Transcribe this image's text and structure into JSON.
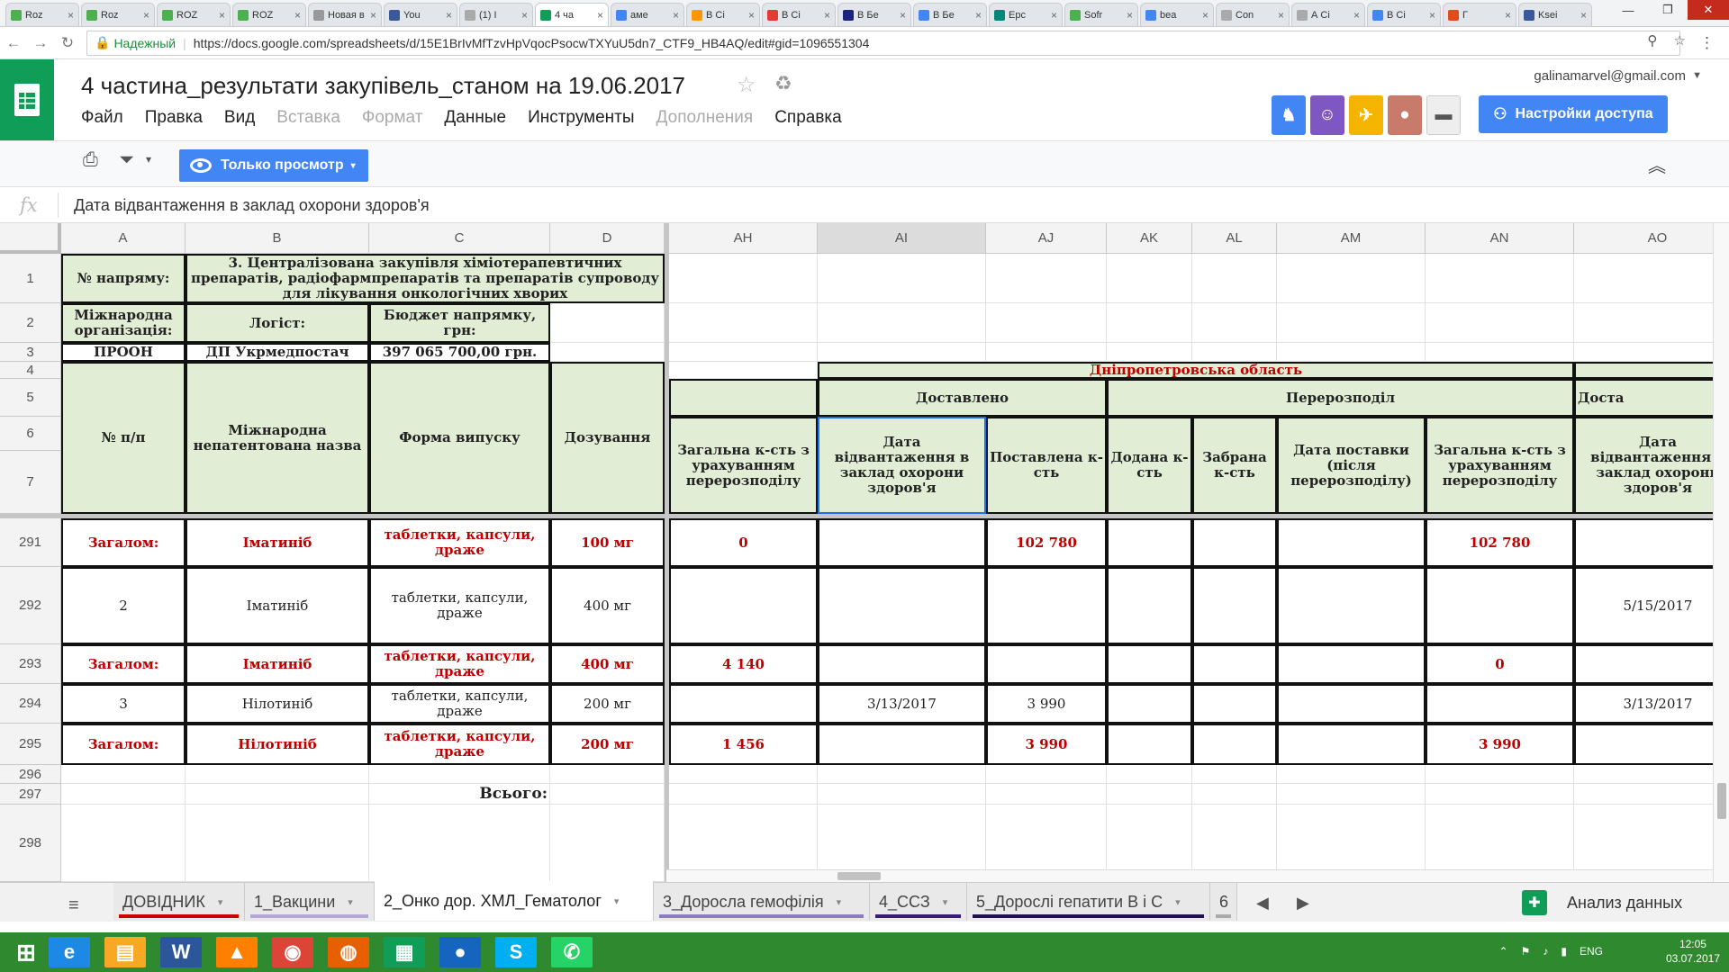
{
  "browser": {
    "tabs": [
      {
        "label": "Roz",
        "color": "#4caf50",
        "active": false
      },
      {
        "label": "Roz",
        "color": "#4caf50",
        "active": false
      },
      {
        "label": "ROZ",
        "color": "#4caf50",
        "active": false
      },
      {
        "label": "ROZ",
        "color": "#4caf50",
        "active": false
      },
      {
        "label": "Новая в",
        "color": "#999999",
        "active": false
      },
      {
        "label": "You",
        "color": "#3b5998",
        "active": false
      },
      {
        "label": "(1) I",
        "color": "#aaaaaa",
        "active": false
      },
      {
        "label": "4 ча",
        "color": "#0f9d58",
        "active": true
      },
      {
        "label": "аме",
        "color": "#4285f4",
        "active": false
      },
      {
        "label": "В Сі",
        "color": "#ff9800",
        "active": false
      },
      {
        "label": "В Сі",
        "color": "#e53935",
        "active": false
      },
      {
        "label": "В Бе",
        "color": "#1a237e",
        "active": false
      },
      {
        "label": "В Бе",
        "color": "#4285f4",
        "active": false
      },
      {
        "label": "Ерс",
        "color": "#00897b",
        "active": false
      },
      {
        "label": "Sofr",
        "color": "#4caf50",
        "active": false
      },
      {
        "label": "bea",
        "color": "#4285f4",
        "active": false
      },
      {
        "label": "Con",
        "color": "#aaaaaa",
        "active": false
      },
      {
        "label": "А Сі",
        "color": "#aaaaaa",
        "active": false
      },
      {
        "label": "В Сі",
        "color": "#4285f4",
        "active": false
      },
      {
        "label": "Г",
        "color": "#e64a19",
        "active": false
      },
      {
        "label": "Ksei",
        "color": "#3b5998",
        "active": false
      }
    ],
    "tab_close": "×",
    "back": "←",
    "forward": "→",
    "reload": "↻",
    "secure_label": "Надежный",
    "url": "https://docs.google.com/spreadsheets/d/15E1BrIvMfTzvHpVqocPsocwTXYuU5dn7_CTF9_HB4AQ/edit#gid=1096551304",
    "icons": {
      "zoom": "⚲",
      "star": "☆",
      "menu": "⋮"
    },
    "window": {
      "minimize": "—",
      "maximize": "❐",
      "close": "✕"
    }
  },
  "doc": {
    "title": "4 частина_результати закупівель_станом на 19.06.2017",
    "star": "☆",
    "drive_icon": "♻",
    "account": "galinamarvel@gmail.com",
    "account_caret": "▼",
    "menu": [
      {
        "label": "Файл",
        "enabled": true
      },
      {
        "label": "Правка",
        "enabled": true
      },
      {
        "label": "Вид",
        "enabled": true
      },
      {
        "label": "Вставка",
        "enabled": false
      },
      {
        "label": "Формат",
        "enabled": false
      },
      {
        "label": "Данные",
        "enabled": true
      },
      {
        "label": "Инструменты",
        "enabled": true
      },
      {
        "label": "Дополнения",
        "enabled": false
      },
      {
        "label": "Справка",
        "enabled": true
      }
    ],
    "collaborators": [
      {
        "icon": "♞",
        "color": "#4285f4"
      },
      {
        "icon": "☺",
        "color": "#7e57c2"
      },
      {
        "icon": "✈",
        "color": "#f4b400"
      },
      {
        "icon": "●",
        "color": "#c97b6b"
      },
      {
        "icon": "▬",
        "color": "#eeeeee"
      }
    ],
    "share_label": "Настройки доступа",
    "share_icon": "⚇"
  },
  "toolbar": {
    "print_icon": "⎙",
    "filter_icon": "⏷",
    "filter_caret": "▾",
    "view_only_label": "Только просмотр",
    "view_only_caret": "▾",
    "collapse_icon": "︽"
  },
  "formula_bar": {
    "fx": "fx",
    "value": "Дата відвантаження в заклад охорони здоров'я"
  },
  "grid": {
    "columns": [
      "A",
      "B",
      "C",
      "D",
      "AH",
      "AI",
      "AJ",
      "AK",
      "AL",
      "AM",
      "AN",
      "AO"
    ],
    "rows": [
      "1",
      "2",
      "3",
      "4",
      "5",
      "6",
      "7",
      "291",
      "292",
      "293",
      "294",
      "295",
      "296",
      "297",
      "298"
    ],
    "header": {
      "direction_label": "№ напряму:",
      "direction_value": "3. Централізована закупівля хіміотерапевтичних препаратів, радіофармпрепаратів та препаратів супроводу для лікування онкологічних хворих",
      "org_label": "Міжнародна організація:",
      "logist_label": "Логіст:",
      "budget_label": "Бюджет напрямку, грн:",
      "org_value": "ПРООН",
      "logist_value": "ДП  Укрмедпостач",
      "budget_value": "397 065 700,00 грн.",
      "np": "№ п/п",
      "inn": "Міжнародна непатентована назва",
      "form": "Форма випуску",
      "dosage": "Дозування",
      "region": "Дніпропетровська область",
      "delivered": "Доставлено",
      "redistribution": "Перерозподіл",
      "delivered_cut": "Доста",
      "total_qty": "Загальна к-сть з урахуванням перерозподілу",
      "ship_date": "Дата відвантаження в заклад охорони здоров'я",
      "supplied_qty": "Поставлена к-сть",
      "added_qty": "Додана к-сть",
      "taken_qty": "Забрана к-сть",
      "delivery_date_after": "Дата поставки (після перерозподілу)",
      "total_qty_2": "Загальна к-сть з урахуванням перерозподілу",
      "ship_date_2": "Дата відвантаження в заклад охорони здоров'я"
    },
    "data_rows": [
      {
        "type": "total",
        "a": "Загалом:",
        "b": "Іматиніб",
        "c": "таблетки, капсули, драже",
        "d": "100 мг",
        "ah": "0",
        "ai": "",
        "aj": "102 780",
        "ak": "",
        "al": "",
        "am": "",
        "an": "102 780",
        "ao": ""
      },
      {
        "type": "item",
        "a": "2",
        "b": "Іматиніб",
        "c": "таблетки, капсули, драже",
        "d": "400 мг",
        "ah": "",
        "ai": "",
        "aj": "",
        "ak": "",
        "al": "",
        "am": "",
        "an": "",
        "ao": "5/15/2017"
      },
      {
        "type": "total",
        "a": "Загалом:",
        "b": "Іматиніб",
        "c": "таблетки, капсули, драже",
        "d": "400 мг",
        "ah": "4 140",
        "ai": "",
        "aj": "",
        "ak": "",
        "al": "",
        "am": "",
        "an": "0",
        "ao": ""
      },
      {
        "type": "item",
        "a": "3",
        "b": "Нілотиніб",
        "c": "таблетки, капсули, драже",
        "d": "200 мг",
        "ah": "",
        "ai": "3/13/2017",
        "aj": "3 990",
        "ak": "",
        "al": "",
        "am": "",
        "an": "",
        "ao": "3/13/2017"
      },
      {
        "type": "total",
        "a": "Загалом:",
        "b": "Нілотиніб",
        "c": "таблетки, капсули, драже",
        "d": "200 мг",
        "ah": "1 456",
        "ai": "",
        "aj": "3 990",
        "ak": "",
        "al": "",
        "am": "",
        "an": "3 990",
        "ao": ""
      }
    ],
    "total_label": "Всього:"
  },
  "sheets": {
    "menu_icon": "≡",
    "tabs": [
      {
        "label": "ДОВІДНИК",
        "color": "#cc0000",
        "active": false
      },
      {
        "label": "1_Вакцини",
        "color": "#b4a7d6",
        "active": false
      },
      {
        "label": "2_Онко дор. ХМЛ_Гематолог",
        "color": "#ffffff",
        "active": true
      },
      {
        "label": "3_Доросла гемофілія",
        "color": "#8e7cc3",
        "active": false
      },
      {
        "label": "4_ССЗ",
        "color": "#351c75",
        "active": false
      },
      {
        "label": "5_Дорослі гепатити В і С",
        "color": "#20124d",
        "active": false
      },
      {
        "label": "6",
        "color": "#aaaaaa",
        "active": false
      }
    ],
    "caret": "▾",
    "prev": "◀",
    "next": "▶",
    "explore_label": "Анализ данных",
    "explore_icon": "✚"
  },
  "taskbar": {
    "start_icon": "⊞",
    "apps": [
      {
        "name": "ie",
        "icon": "e",
        "color": "#1e88e5"
      },
      {
        "name": "explorer",
        "icon": "▤",
        "color": "#f9a825"
      },
      {
        "name": "word",
        "icon": "W",
        "color": "#2b579a"
      },
      {
        "name": "vlc",
        "icon": "▲",
        "color": "#ff7f00"
      },
      {
        "name": "chrome",
        "icon": "◉",
        "color": "#db4437"
      },
      {
        "name": "firefox",
        "icon": "◍",
        "color": "#e66000"
      },
      {
        "name": "sheets",
        "icon": "▦",
        "color": "#0f9d58"
      },
      {
        "name": "earth",
        "icon": "●",
        "color": "#1565c0"
      },
      {
        "name": "skype",
        "icon": "S",
        "color": "#00aff0"
      },
      {
        "name": "whatsapp",
        "icon": "✆",
        "color": "#25d366"
      }
    ],
    "tray": {
      "arrow": "⌃",
      "flag": "⚑",
      "speaker": "♪",
      "network": "▮",
      "lang": "ENG"
    },
    "time": "12:05",
    "date": "03.07.2017"
  }
}
